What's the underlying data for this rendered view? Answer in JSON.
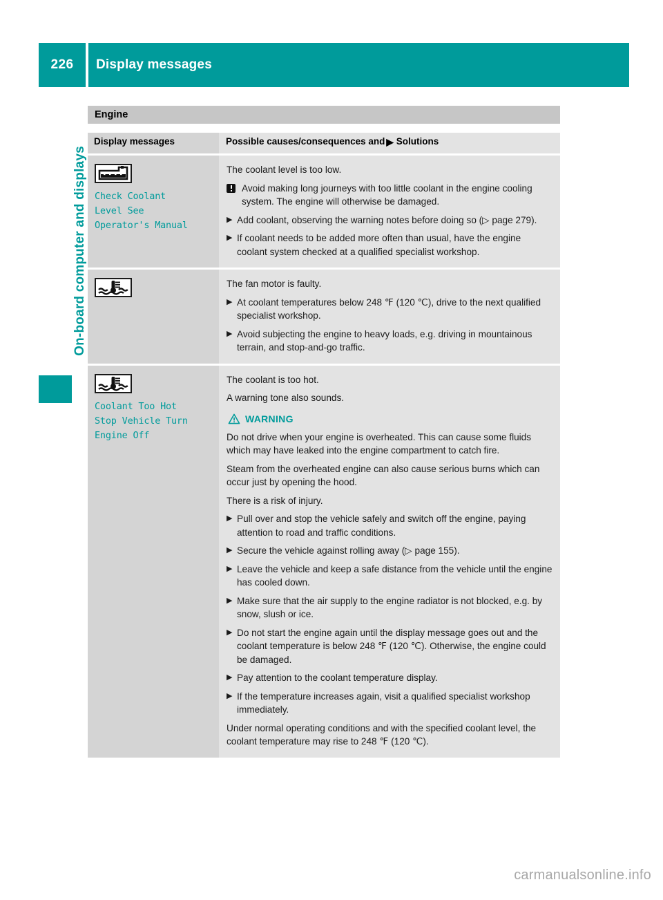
{
  "header": {
    "page_number": "226",
    "title": "Display messages"
  },
  "sidebar": {
    "chapter_label": "On-board computer and displays"
  },
  "section": {
    "title": "Engine"
  },
  "table": {
    "col_headers": {
      "left": "Display messages",
      "right_before": "Possible causes/consequences and",
      "right_after": "Solutions"
    },
    "rows": [
      {
        "icon_name": "coolant-reservoir-level-icon",
        "message": "Check Coolant\nLevel See\nOperator's Manual",
        "blocks": [
          {
            "kind": "para",
            "text": "The coolant level is too low."
          },
          {
            "kind": "note",
            "text": "Avoid making long journeys with too little coolant in the engine cooling system. The engine will otherwise be damaged."
          },
          {
            "kind": "bullet",
            "text": "Add coolant, observing the warning notes before doing so (▷ page 279)."
          },
          {
            "kind": "bullet",
            "text": "If coolant needs to be added more often than usual, have the engine coolant system checked at a qualified specialist workshop."
          }
        ]
      },
      {
        "icon_name": "coolant-temperature-icon",
        "message": "",
        "blocks": [
          {
            "kind": "para",
            "text": "The fan motor is faulty."
          },
          {
            "kind": "bullet",
            "text": "At coolant temperatures below 248 ℉ (120 ℃), drive to the next qualified specialist workshop."
          },
          {
            "kind": "bullet",
            "text": "Avoid subjecting the engine to heavy loads, e.g. driving in mountainous terrain, and stop-and-go traffic."
          }
        ]
      },
      {
        "icon_name": "coolant-temperature-icon",
        "message": "Coolant Too Hot\nStop Vehicle Turn\nEngine Off",
        "blocks": [
          {
            "kind": "para",
            "text": "The coolant is too hot."
          },
          {
            "kind": "para",
            "text": "A warning tone also sounds."
          },
          {
            "kind": "warning-head",
            "text": "WARNING"
          },
          {
            "kind": "para",
            "text": "Do not drive when your engine is overheated. This can cause some fluids which may have leaked into the engine compartment to catch fire."
          },
          {
            "kind": "para",
            "text": "Steam from the overheated engine can also cause serious burns which can occur just by opening the hood."
          },
          {
            "kind": "para",
            "text": "There is a risk of injury."
          },
          {
            "kind": "bullet",
            "text": "Pull over and stop the vehicle safely and switch off the engine, paying attention to road and traffic conditions."
          },
          {
            "kind": "bullet",
            "text": "Secure the vehicle against rolling away (▷ page 155)."
          },
          {
            "kind": "bullet",
            "text": "Leave the vehicle and keep a safe distance from the vehicle until the engine has cooled down."
          },
          {
            "kind": "bullet",
            "text": "Make sure that the air supply to the engine radiator is not blocked, e.g. by snow, slush or ice."
          },
          {
            "kind": "bullet",
            "text": "Do not start the engine again until the display message goes out and the coolant temperature is below 248 ℉ (120 ℃). Otherwise, the engine could be damaged."
          },
          {
            "kind": "bullet",
            "text": "Pay attention to the coolant temperature display."
          },
          {
            "kind": "bullet",
            "text": "If the temperature increases again, visit a qualified specialist workshop immediately."
          },
          {
            "kind": "para",
            "text": "Under normal operating conditions and with the specified coolant level, the coolant temperature may rise to 248 ℉ (120 ℃)."
          }
        ]
      }
    ]
  },
  "icons": {
    "solid_triangle": "▶",
    "outline_triangle": "▷"
  },
  "watermark": {
    "text": "carmanualsonline.info"
  },
  "colors": {
    "brand_teal": "#009B9B",
    "header_gray": "#c6c6c6",
    "left_cell_gray": "#d4d4d4",
    "right_cell_gray": "#e3e3e3"
  }
}
